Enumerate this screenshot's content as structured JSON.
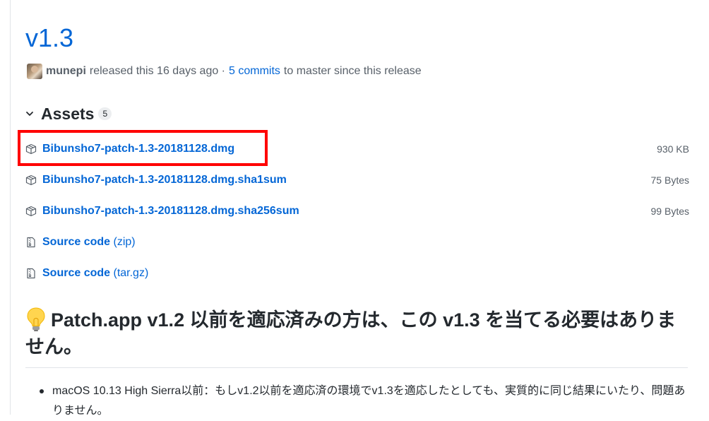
{
  "release": {
    "title": "v1.3",
    "author": "munepi",
    "released_text": "released this 16 days ago ·",
    "commits_link": "5 commits",
    "commits_suffix": "to master since this release"
  },
  "assets": {
    "title": "Assets",
    "count": "5",
    "items": [
      {
        "name": "Bibunsho7-patch-1.3-20181128.dmg",
        "size": "930 KB",
        "icon": "package-icon"
      },
      {
        "name": "Bibunsho7-patch-1.3-20181128.dmg.sha1sum",
        "size": "75 Bytes",
        "icon": "package-icon"
      },
      {
        "name": "Bibunsho7-patch-1.3-20181128.dmg.sha256sum",
        "size": "99 Bytes",
        "icon": "package-icon"
      },
      {
        "name": "Source code",
        "suffix": "(zip)",
        "icon": "file-zip-icon"
      },
      {
        "name": "Source code",
        "suffix": "(tar.gz)",
        "icon": "file-zip-icon"
      }
    ]
  },
  "notes": {
    "heading": "Patch.app v1.2 以前を適応済みの方は、この v1.3 を当てる必要はありません。",
    "heading_icon": "light-bulb-icon",
    "bullets": [
      "macOS 10.13 High Sierra以前：もしv1.2以前を適応済の環境でv1.3を適応したとしても、実質的に同じ結果にいたり、問題ありません。"
    ]
  },
  "colors": {
    "link": "#0366d6",
    "highlight": "#ff0000",
    "muted": "#586069"
  }
}
